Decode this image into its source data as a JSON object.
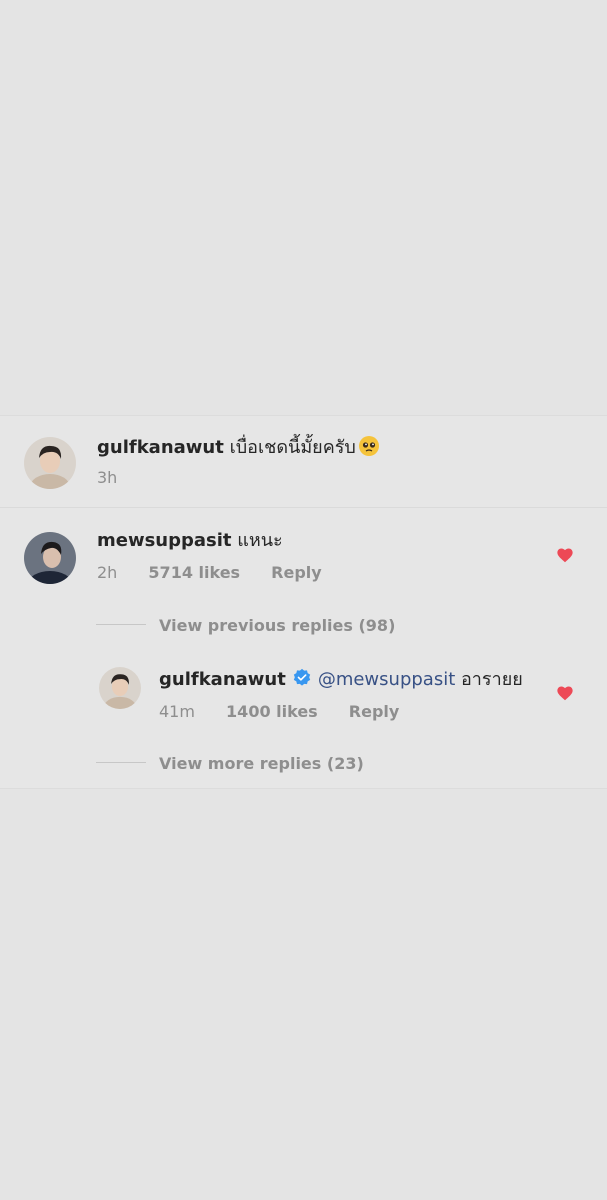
{
  "caption": {
    "username": "gulfkanawut",
    "text": "เบื่อเชดนี้มั้ยครับ",
    "emoji_icon": "pleading-face-emoji",
    "time": "3h"
  },
  "comment": {
    "username": "mewsuppasit",
    "text": "แหนะ",
    "time": "2h",
    "likes": "5714 likes",
    "reply_label": "Reply",
    "liked": true,
    "heart_color": "#ed4956"
  },
  "view_previous_label": "View previous replies (98)",
  "reply": {
    "username": "gulfkanawut",
    "verified_icon": "verified-badge-icon",
    "verified_color": "#3897f0",
    "mention": "@mewsuppasit",
    "text": "อารายย",
    "time": "41m",
    "likes": "1400 likes",
    "reply_label": "Reply",
    "liked": true
  },
  "view_more_label": "View more replies (23)"
}
